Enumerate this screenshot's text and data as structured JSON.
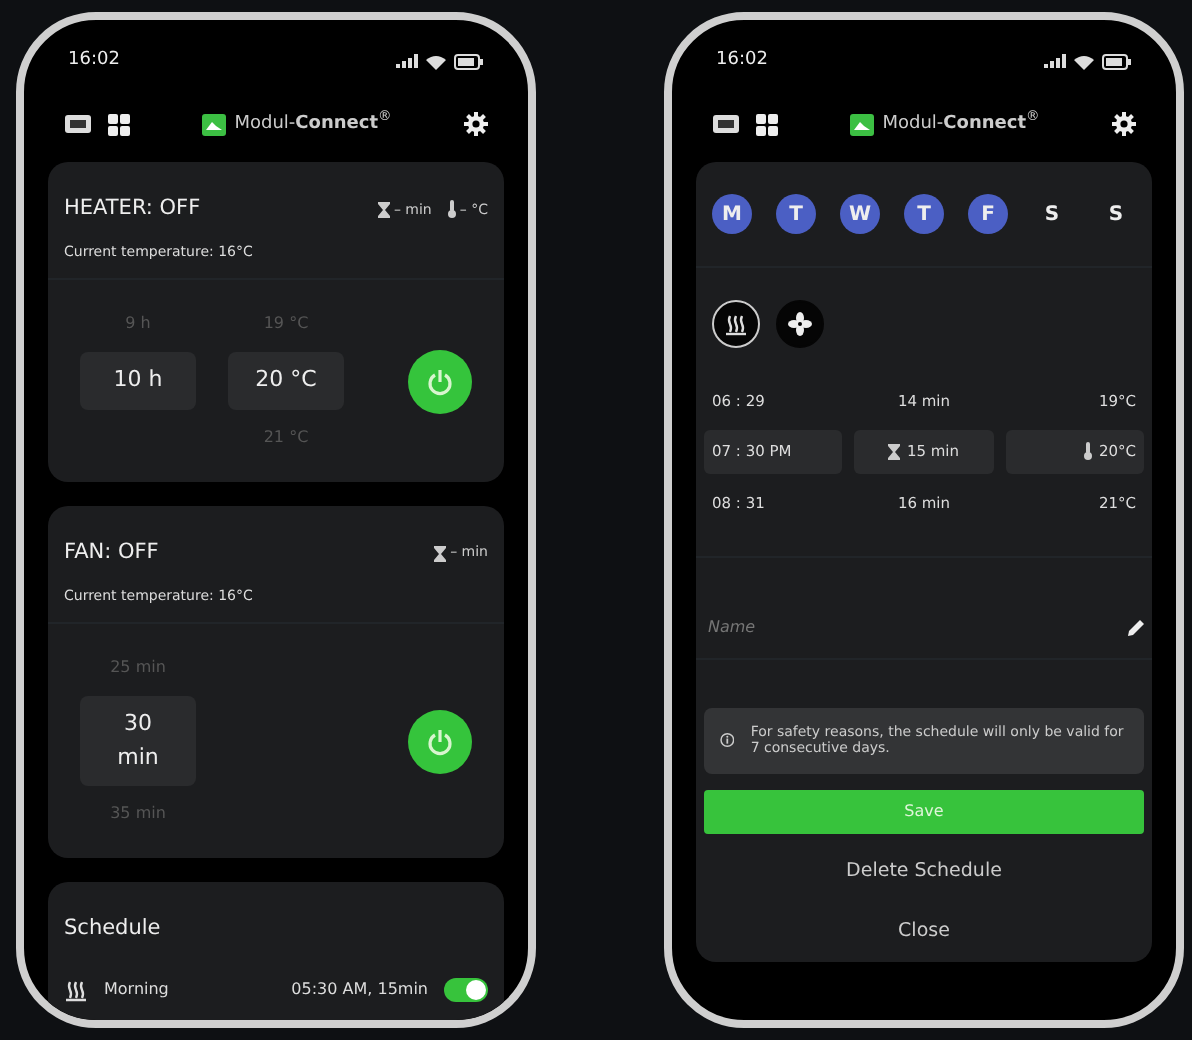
{
  "phones": [
    {
      "kind": "dashboard",
      "status_time": "16:02",
      "brand": "Modul-**Connect**$^{®}$",
      "devices": [
        {
          "title": "HEATER: OFF",
          "readings": [
            {
              "kind": "timer",
              "text": "– min"
            },
            {
              "kind": "temp",
              "text": "– °C"
            }
          ],
          "current": "Current temperature: 16°C",
          "pickers": [
            {
              "above": "9 h",
              "value": "10 h"
            },
            {
              "above": "19 °C",
              "value": "20 °C",
              "below": "21 °C"
            }
          ]
        },
        {
          "title": "FAN: OFF",
          "readings": [
            {
              "kind": "timer",
              "text": "– min"
            }
          ],
          "current": "Current temperature: 16°C",
          "pickers": [
            {
              "above": "25 min",
              "value": "30 min",
              "below": "35 min"
            }
          ]
        }
      ],
      "schedule": {
        "title": "Schedule",
        "items": [
          {
            "kind": "heater",
            "name": "Morning",
            "time": "05:30 AM, 15min",
            "on": true
          }
        ]
      }
    },
    {
      "kind": "editor",
      "status_time": "16:02",
      "brand": "Modul-**Connect**$^{®}$",
      "days": [
        {
          "label": "M",
          "selected": true
        },
        {
          "label": "T",
          "selected": true
        },
        {
          "label": "W",
          "selected": true
        },
        {
          "label": "T",
          "selected": true
        },
        {
          "label": "F",
          "selected": true
        },
        {
          "label": "S",
          "selected": false
        },
        {
          "label": "S",
          "selected": false
        }
      ],
      "modes": [
        {
          "kind": "heater",
          "selected": true
        },
        {
          "kind": "fan",
          "selected": false
        }
      ],
      "rows": [
        {
          "time": "06 : 29",
          "duration": "14 min",
          "temp": "19°C",
          "selected": false
        },
        {
          "time": "07 : 30 PM",
          "duration": "15 min",
          "temp": "20°C",
          "selected": true
        },
        {
          "time": "08 : 31",
          "duration": "16 min",
          "temp": "21°C",
          "selected": false
        }
      ],
      "name_field": {
        "placeholder": "Name"
      },
      "notice": "For safety reasons, the schedule will only be valid for 7 consecutive days.",
      "buttons": [
        {
          "kind": "primary",
          "label": "Save"
        },
        {
          "kind": "plain",
          "label": "Delete Schedule"
        },
        {
          "kind": "plain",
          "label": "Close"
        }
      ]
    }
  ]
}
